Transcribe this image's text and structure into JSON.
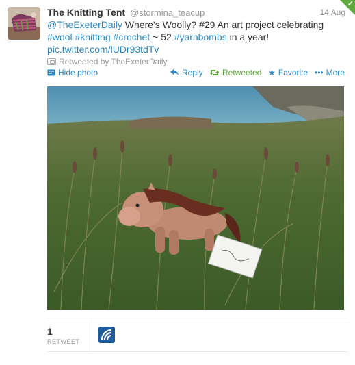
{
  "tweet": {
    "fullname": "The Knitting Tent",
    "username": "@stormina_teacup",
    "timestamp": "14 Aug",
    "mention": "@TheExeterDaily",
    "text_part1": " Where's Woolly? #29 An art project celebrating ",
    "hashtag_wool": "#wool",
    "hashtag_knitting": "#knitting",
    "hashtag_crochet": "#crochet",
    "text_part2": " ~ 52 ",
    "hashtag_yarnbombs": "#yarnbombs",
    "text_part3": " in a year!",
    "link": "pic.twitter.com/lUDr93tdTv",
    "retweeted_by": "Retweeted by TheExeterDaily"
  },
  "actions": {
    "hide_photo": "Hide photo",
    "reply": "Reply",
    "retweeted": "Retweeted",
    "favorite": "Favorite",
    "more": "More"
  },
  "stats": {
    "retweet_count": "1",
    "retweet_label": "RETWEET"
  },
  "colors": {
    "link": "#2a89c4",
    "retweeted_green": "#5fa83a",
    "muted": "#999999"
  },
  "icons": {
    "hide_photo": "photo-icon",
    "reply": "reply-arrow-icon",
    "retweeted": "retweet-icon",
    "favorite": "star-icon",
    "more": "dots-icon"
  }
}
